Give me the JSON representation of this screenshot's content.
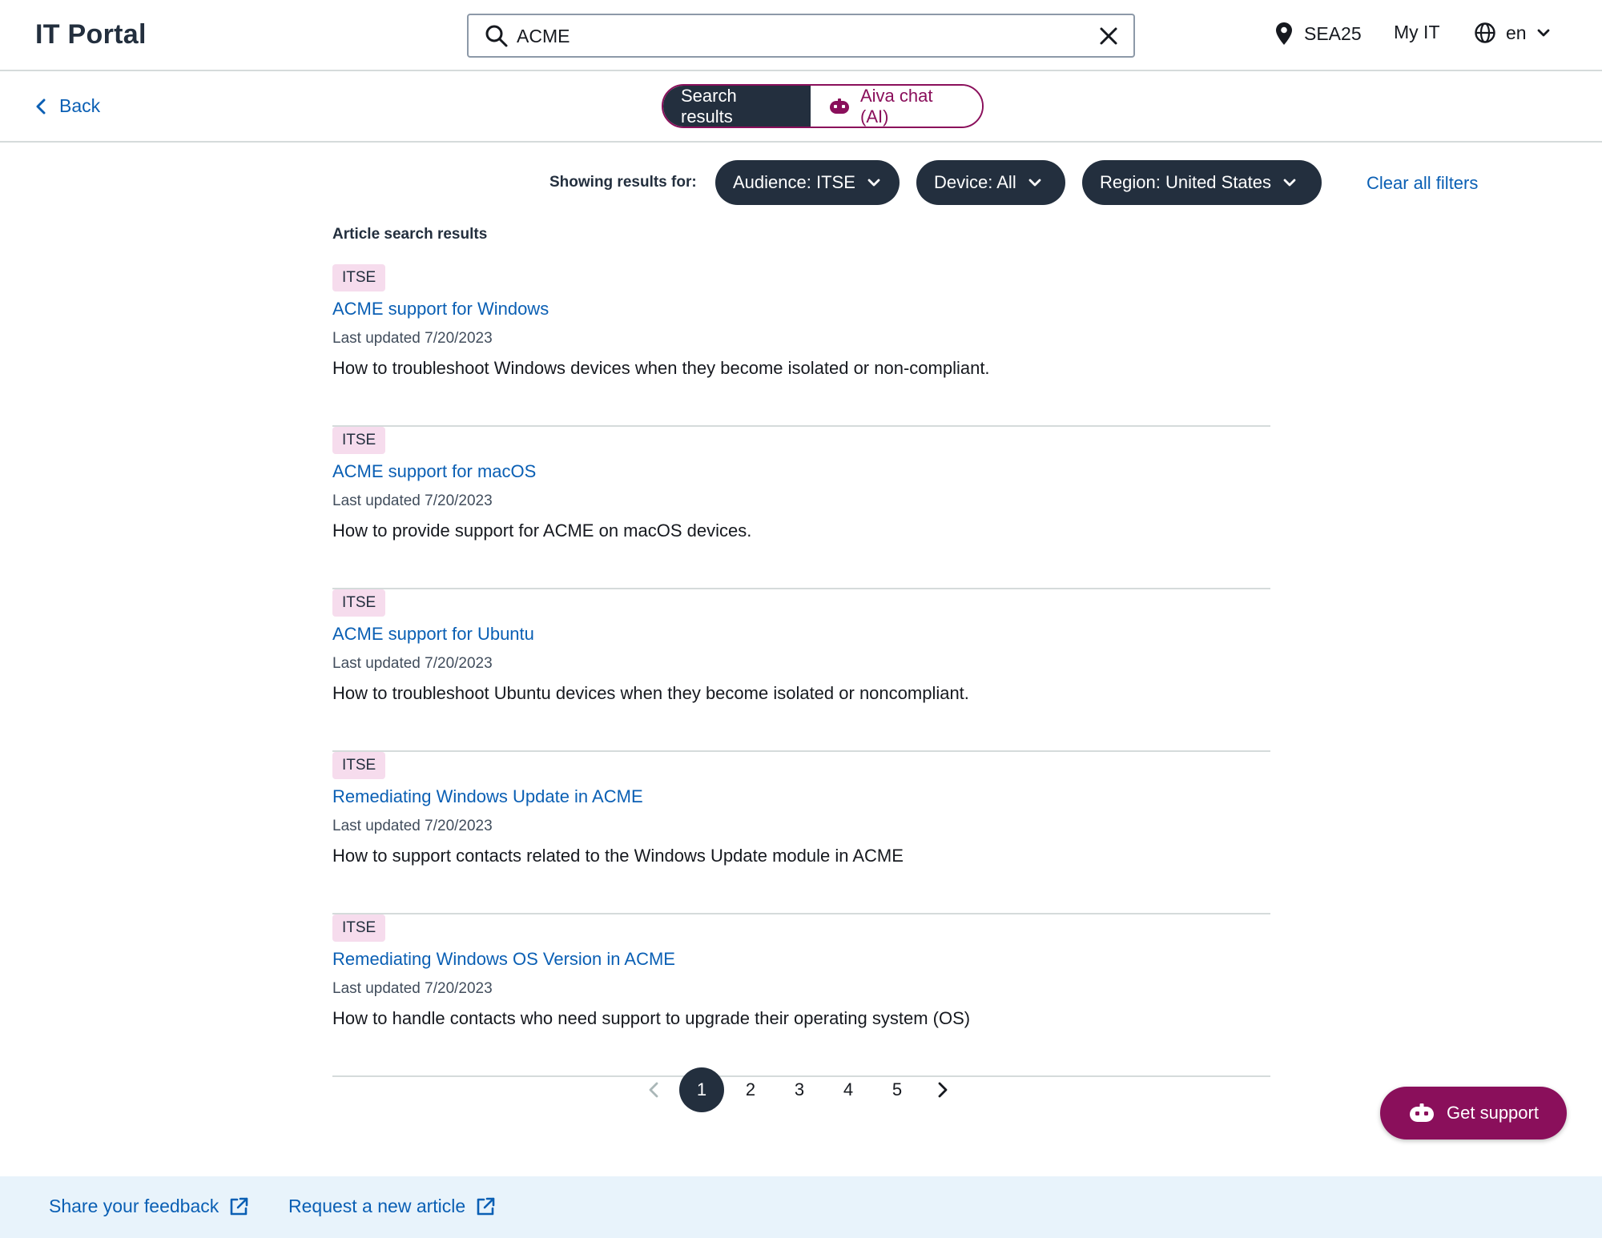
{
  "header": {
    "logo": "IT Portal",
    "search": {
      "value": "ACME",
      "placeholder": ""
    },
    "location": "SEA25",
    "my_it": "My IT",
    "language": "en"
  },
  "subbar": {
    "back": "Back",
    "tabs": {
      "search_results": "Search results",
      "aiva_chat": "Aiva chat (AI)"
    }
  },
  "filters": {
    "showing_label": "Showing results for:",
    "audience": "Audience: ITSE",
    "device": "Device: All",
    "region": "Region: United States",
    "clear_all": "Clear all filters"
  },
  "results": {
    "section_title": "Article search results",
    "items": [
      {
        "badge": "ITSE",
        "title": "ACME support for Windows",
        "updated": "Last updated 7/20/2023",
        "description": "How to troubleshoot Windows devices when they become isolated or non-compliant."
      },
      {
        "badge": "ITSE",
        "title": "ACME support for macOS",
        "updated": "Last updated 7/20/2023",
        "description": "How to provide support for ACME on macOS devices."
      },
      {
        "badge": "ITSE",
        "title": "ACME support for Ubuntu",
        "updated": "Last updated 7/20/2023",
        "description": "How to troubleshoot Ubuntu devices when they become isolated or noncompliant."
      },
      {
        "badge": "ITSE",
        "title": "Remediating Windows Update in ACME",
        "updated": "Last updated 7/20/2023",
        "description": "How to support contacts related to the Windows Update module in ACME"
      },
      {
        "badge": "ITSE",
        "title": "Remediating Windows OS Version in ACME",
        "updated": "Last updated 7/20/2023",
        "description": "How to handle contacts who need support to upgrade their operating system (OS)"
      }
    ]
  },
  "pagination": {
    "pages": [
      "1",
      "2",
      "3",
      "4",
      "5"
    ],
    "current": "1"
  },
  "support_button": "Get support",
  "footer": {
    "feedback": "Share your feedback",
    "request": "Request a new article"
  },
  "colors": {
    "navy": "#232f3e",
    "link": "#0a5fb4",
    "accent": "#8a0f5b",
    "badge_bg": "#f6dced",
    "footer_bg": "#e8f3fb"
  },
  "icons": [
    "search-icon",
    "close-icon",
    "location-pin-icon",
    "globe-icon",
    "chevron-down-icon",
    "chevron-left-icon",
    "chevron-right-icon",
    "robot-icon",
    "external-link-icon"
  ]
}
